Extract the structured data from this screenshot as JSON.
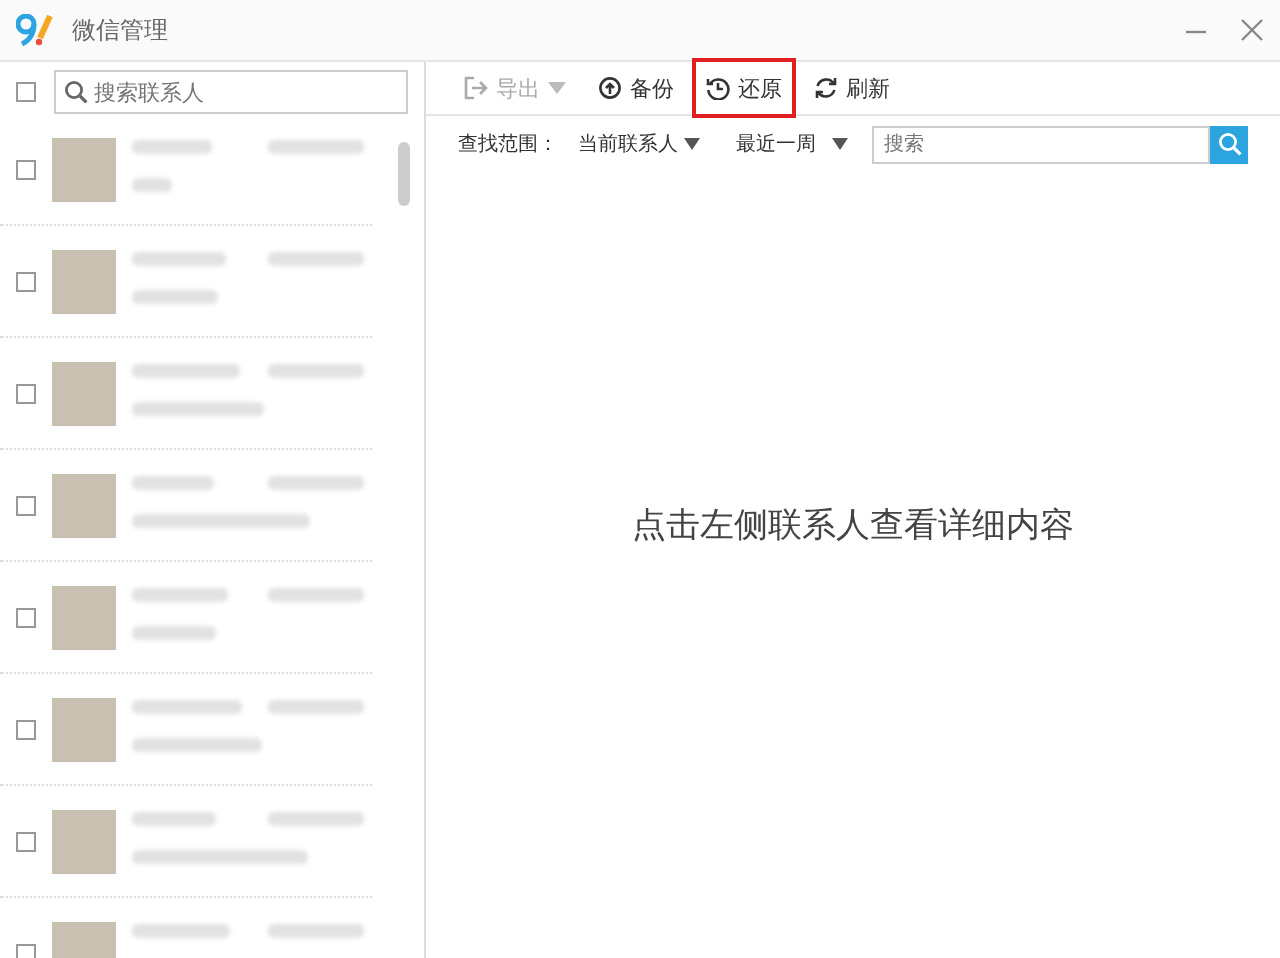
{
  "window": {
    "title": "微信管理"
  },
  "contact_search": {
    "placeholder": "搜索联系人",
    "select_all_checked": false
  },
  "contacts": [
    {
      "checked": false
    },
    {
      "checked": false
    },
    {
      "checked": false
    },
    {
      "checked": false
    },
    {
      "checked": false
    },
    {
      "checked": false
    },
    {
      "checked": false
    },
    {
      "checked": false
    }
  ],
  "toolbar": [
    {
      "label": "导出",
      "kind": "export",
      "disabled": true,
      "highlighted": false
    },
    {
      "label": "备份",
      "kind": "backup",
      "disabled": false,
      "highlighted": false
    },
    {
      "label": "还原",
      "kind": "restore",
      "disabled": false,
      "highlighted": true
    },
    {
      "label": "刷新",
      "kind": "refresh",
      "disabled": false,
      "highlighted": false
    }
  ],
  "filter": {
    "label": "查找范围：",
    "scope": "当前联系人",
    "period": "最近一周",
    "search_placeholder": "搜索"
  },
  "empty_message": "点击左侧联系人查看详细内容"
}
